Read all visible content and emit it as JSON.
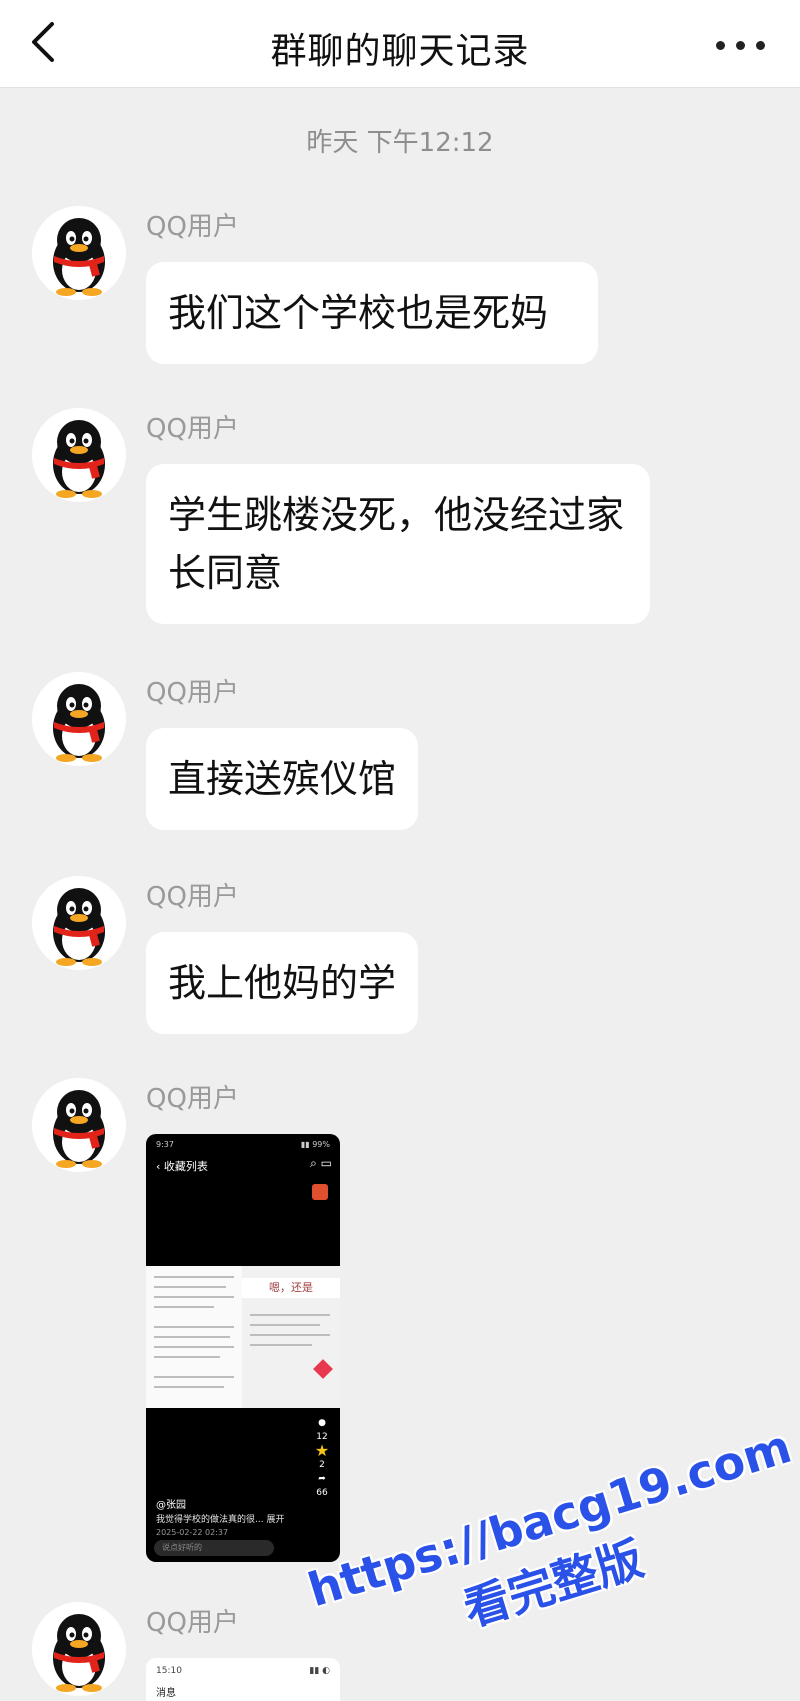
{
  "header": {
    "title": "群聊的聊天记录",
    "back_icon": "chevron-left-icon",
    "more_icon": "more-horizontal-icon"
  },
  "timestamp": "昨天 下午12:12",
  "messages": [
    {
      "sender": "QQ用户",
      "text": "我们这个学校也是死妈"
    },
    {
      "sender": "QQ用户",
      "text": "学生跳楼没死，他没经过家长同意"
    },
    {
      "sender": "QQ用户",
      "text": "直接送殡仪馆"
    },
    {
      "sender": "QQ用户",
      "text": "我上他妈的学"
    },
    {
      "sender": "QQ用户",
      "image": {
        "nav_title": "收藏列表",
        "banner_text": "嗯，还是",
        "side_counts": [
          "12",
          "2",
          "66"
        ],
        "user": "@张园",
        "desc": "我觉得学校的做法真的很... 展开",
        "date": "2025-02-22 02:37",
        "comment_placeholder": "说点好听的"
      }
    },
    {
      "sender": "QQ用户",
      "image2": {
        "time": "15:10",
        "line": "消息"
      }
    }
  ],
  "watermark": {
    "line1": "https://bacg19.com",
    "line2": "看完整版"
  },
  "colors": {
    "background": "#efefef",
    "bubble": "#ffffff",
    "watermark": "#2b52e8"
  }
}
